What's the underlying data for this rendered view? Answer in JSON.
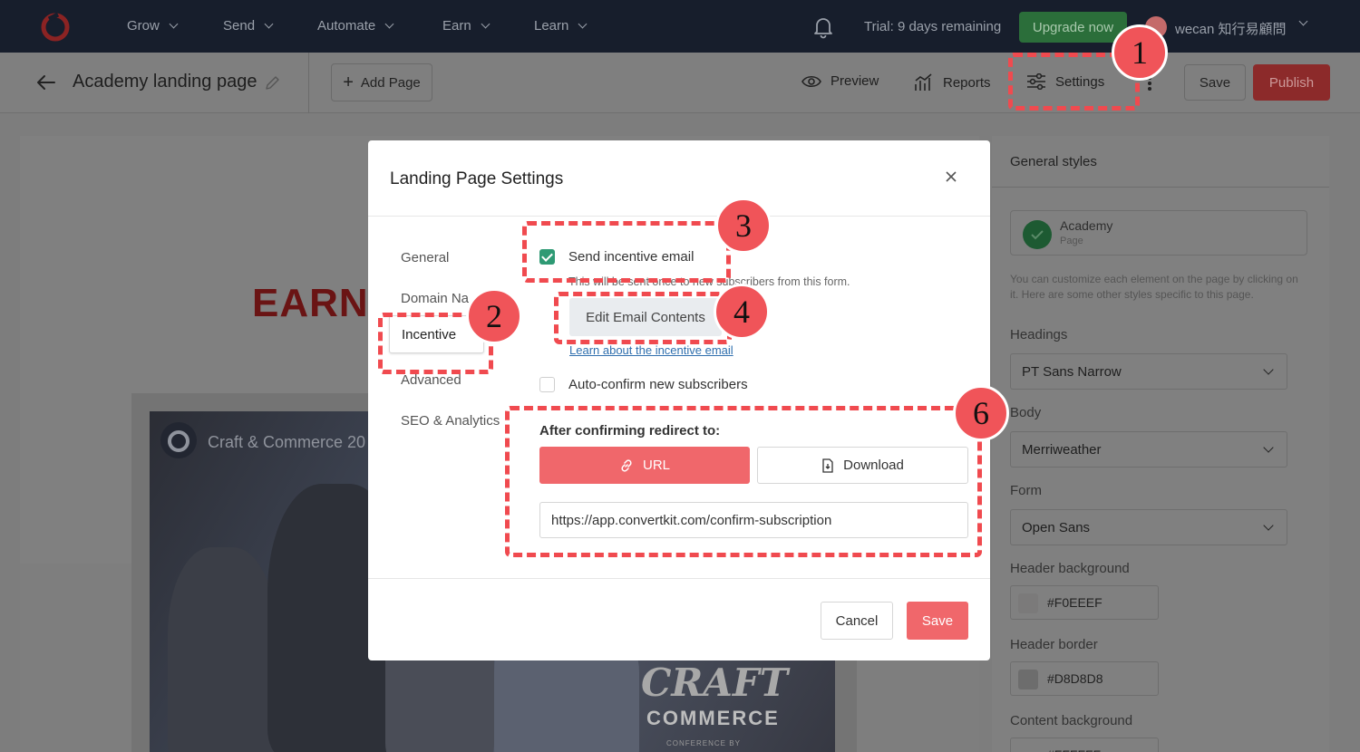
{
  "topnav": {
    "menu": [
      {
        "label": "Grow"
      },
      {
        "label": "Send"
      },
      {
        "label": "Automate"
      },
      {
        "label": "Earn"
      },
      {
        "label": "Learn"
      }
    ],
    "trial_text": "Trial: 9 days remaining",
    "upgrade_label": "Upgrade now",
    "user_name": "wecan 知行易顧問"
  },
  "toolbar": {
    "page_title": "Academy landing page",
    "add_page_label": "Add Page",
    "preview_label": "Preview",
    "reports_label": "Reports",
    "settings_label": "Settings",
    "save_label": "Save",
    "publish_label": "Publish"
  },
  "canvas": {
    "headline": "EARN A",
    "video_title": "Craft & Commerce 20",
    "brand_line1": "CRAFT",
    "brand_line2": "COMMERCE",
    "brand_line3": "CONFERENCE BY"
  },
  "sidebar": {
    "title": "General styles",
    "card_title": "Academy",
    "card_subtitle": "Page",
    "description": "You can customize each element on the page by clicking on it. Here are some other styles specific to this page.",
    "headings_label": "Headings",
    "headings_value": "PT Sans Narrow",
    "body_label": "Body",
    "body_value": "Merriweather",
    "form_label": "Form",
    "form_value": "Open Sans",
    "header_bg_label": "Header background",
    "header_bg_value": "#F0EEEF",
    "header_border_label": "Header border",
    "header_border_value": "#D8D8D8",
    "content_bg_label": "Content background",
    "content_bg_value": "#FFFFFF"
  },
  "modal": {
    "title": "Landing Page Settings",
    "nav": [
      {
        "label": "General"
      },
      {
        "label": "Domain Na"
      },
      {
        "label": "Incentive"
      },
      {
        "label": "Advanced"
      },
      {
        "label": "SEO & Analytics"
      }
    ],
    "send_incentive_label": "Send incentive email",
    "send_incentive_checked": true,
    "incentive_hint": "This will be sent once to new subscribers from this form.",
    "edit_email_label": "Edit Email Contents",
    "learn_link": "Learn about the incentive email",
    "auto_confirm_label": "Auto-confirm new subscribers",
    "auto_confirm_checked": false,
    "redirect_label": "After confirming redirect to:",
    "url_label": "URL",
    "download_label": "Download",
    "redirect_url": "https://app.convertkit.com/confirm-subscription",
    "cancel_label": "Cancel",
    "save_label": "Save"
  },
  "annotations": [
    {
      "number": "1"
    },
    {
      "number": "2"
    },
    {
      "number": "3"
    },
    {
      "number": "4"
    },
    {
      "number": "6"
    }
  ],
  "colors": {
    "accent": "#F0676B",
    "annotation": "#F04A4F",
    "check": "#2E9A74",
    "nav_bg": "#171E2C"
  }
}
